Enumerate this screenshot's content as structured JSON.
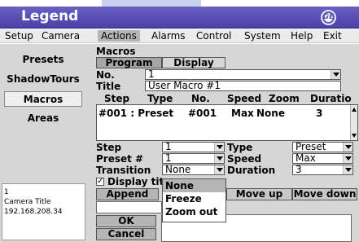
{
  "app": {
    "title": "Legend",
    "logo_text": "GE"
  },
  "menu": [
    "Setup",
    "Camera",
    "Actions",
    "Alarms",
    "Control",
    "System",
    "Help",
    "Exit"
  ],
  "sidebar": {
    "items": [
      "Presets",
      "ShadowTours",
      "Macros",
      "Areas"
    ],
    "selected": "Macros",
    "camera_info": {
      "number": "1",
      "title": "Camera Title",
      "ip": "192.168.208.34"
    }
  },
  "macros": {
    "section_title": "Macros",
    "tabs": [
      "Program",
      "Display"
    ],
    "no_label": "No.",
    "no_value": "1",
    "title_label": "Title",
    "title_value": "User Macro #1",
    "columns": [
      "Step",
      "Type",
      "No.",
      "Speed",
      "Zoom",
      "Duratio"
    ],
    "rows": [
      {
        "step": "#001 : Preset",
        "no": "#001",
        "speed": "Max",
        "zoom": "None",
        "duration": "3"
      }
    ],
    "form": {
      "step_label": "Step",
      "step_value": "1",
      "preset_label": "Preset #",
      "preset_value": "1",
      "transition_label": "Transition",
      "transition_value": "None",
      "type_label": "Type",
      "type_value": "Preset",
      "speed_label": "Speed",
      "speed_value": "Max",
      "duration_label": "Duration",
      "duration_value": "3",
      "display_title_label": "Display tit",
      "display_title_checked": true
    },
    "transition_options": [
      "None",
      "Freeze",
      "Zoom out"
    ],
    "transition_highlighted": "None",
    "buttons": {
      "append": "Append",
      "move_up": "Move up",
      "move_down": "Move down",
      "ok": "OK",
      "cancel": "Cancel"
    }
  }
}
